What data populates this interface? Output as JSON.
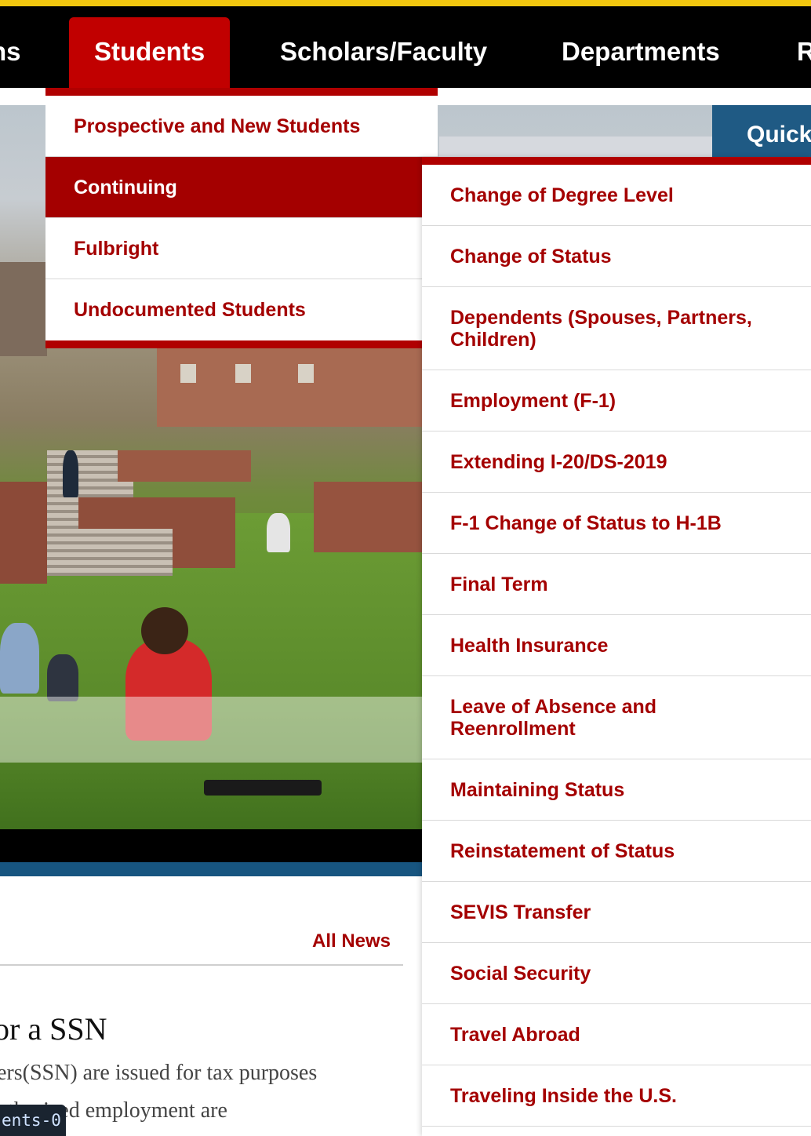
{
  "nav": {
    "items": [
      {
        "label": "ns"
      },
      {
        "label": "Students"
      },
      {
        "label": "Scholars/Faculty"
      },
      {
        "label": "Departments"
      },
      {
        "label": "R"
      }
    ],
    "active_index": 1
  },
  "quick_button": {
    "label": "Quick"
  },
  "students_menu": {
    "items": [
      {
        "label": "Prospective and New Students"
      },
      {
        "label": "Continuing"
      },
      {
        "label": "Fulbright"
      },
      {
        "label": "Undocumented Students"
      }
    ],
    "active_index": 1
  },
  "continuing_submenu": {
    "items": [
      {
        "label": "Change of Degree Level"
      },
      {
        "label": "Change of Status"
      },
      {
        "label": "Dependents (Spouses, Partners, Children)"
      },
      {
        "label": "Employment (F-1)"
      },
      {
        "label": "Extending I-20/DS-2019"
      },
      {
        "label": "F-1 Change of Status to H-1B"
      },
      {
        "label": "Final Term"
      },
      {
        "label": "Health Insurance"
      },
      {
        "label": "Leave of Absence and Reenrollment"
      },
      {
        "label": "Maintaining Status"
      },
      {
        "label": "Reinstatement of Status"
      },
      {
        "label": "SEVIS Transfer"
      },
      {
        "label": "Social Security"
      },
      {
        "label": "Travel Abroad"
      },
      {
        "label": "Traveling Inside the U.S."
      }
    ]
  },
  "news": {
    "all_news_label": "All News",
    "headline": "or a SSN",
    "line1": "ers(SSN) are issued for tax purposes",
    "line2": "uthorized employment are"
  },
  "debug_badge": {
    "label": "ents-0"
  }
}
